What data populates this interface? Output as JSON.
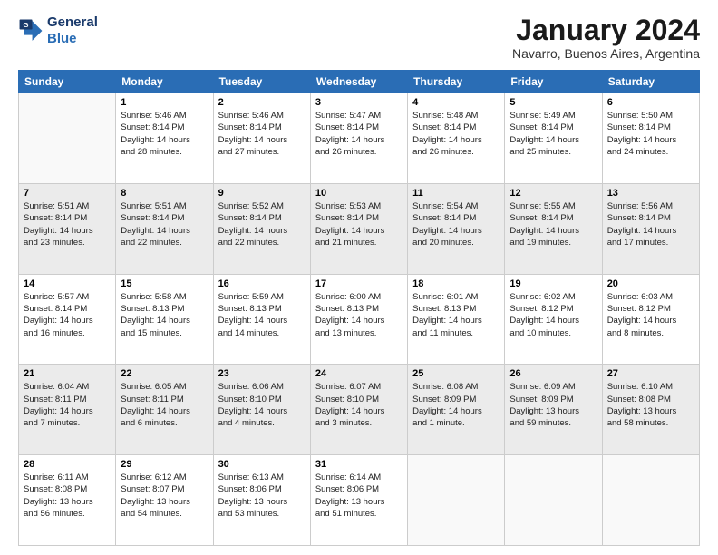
{
  "logo": {
    "line1": "General",
    "line2": "Blue"
  },
  "title": "January 2024",
  "subtitle": "Navarro, Buenos Aires, Argentina",
  "days_of_week": [
    "Sunday",
    "Monday",
    "Tuesday",
    "Wednesday",
    "Thursday",
    "Friday",
    "Saturday"
  ],
  "weeks": [
    [
      {
        "num": "",
        "info": ""
      },
      {
        "num": "1",
        "info": "Sunrise: 5:46 AM\nSunset: 8:14 PM\nDaylight: 14 hours\nand 28 minutes."
      },
      {
        "num": "2",
        "info": "Sunrise: 5:46 AM\nSunset: 8:14 PM\nDaylight: 14 hours\nand 27 minutes."
      },
      {
        "num": "3",
        "info": "Sunrise: 5:47 AM\nSunset: 8:14 PM\nDaylight: 14 hours\nand 26 minutes."
      },
      {
        "num": "4",
        "info": "Sunrise: 5:48 AM\nSunset: 8:14 PM\nDaylight: 14 hours\nand 26 minutes."
      },
      {
        "num": "5",
        "info": "Sunrise: 5:49 AM\nSunset: 8:14 PM\nDaylight: 14 hours\nand 25 minutes."
      },
      {
        "num": "6",
        "info": "Sunrise: 5:50 AM\nSunset: 8:14 PM\nDaylight: 14 hours\nand 24 minutes."
      }
    ],
    [
      {
        "num": "7",
        "info": "Sunrise: 5:51 AM\nSunset: 8:14 PM\nDaylight: 14 hours\nand 23 minutes."
      },
      {
        "num": "8",
        "info": "Sunrise: 5:51 AM\nSunset: 8:14 PM\nDaylight: 14 hours\nand 22 minutes."
      },
      {
        "num": "9",
        "info": "Sunrise: 5:52 AM\nSunset: 8:14 PM\nDaylight: 14 hours\nand 22 minutes."
      },
      {
        "num": "10",
        "info": "Sunrise: 5:53 AM\nSunset: 8:14 PM\nDaylight: 14 hours\nand 21 minutes."
      },
      {
        "num": "11",
        "info": "Sunrise: 5:54 AM\nSunset: 8:14 PM\nDaylight: 14 hours\nand 20 minutes."
      },
      {
        "num": "12",
        "info": "Sunrise: 5:55 AM\nSunset: 8:14 PM\nDaylight: 14 hours\nand 19 minutes."
      },
      {
        "num": "13",
        "info": "Sunrise: 5:56 AM\nSunset: 8:14 PM\nDaylight: 14 hours\nand 17 minutes."
      }
    ],
    [
      {
        "num": "14",
        "info": "Sunrise: 5:57 AM\nSunset: 8:14 PM\nDaylight: 14 hours\nand 16 minutes."
      },
      {
        "num": "15",
        "info": "Sunrise: 5:58 AM\nSunset: 8:13 PM\nDaylight: 14 hours\nand 15 minutes."
      },
      {
        "num": "16",
        "info": "Sunrise: 5:59 AM\nSunset: 8:13 PM\nDaylight: 14 hours\nand 14 minutes."
      },
      {
        "num": "17",
        "info": "Sunrise: 6:00 AM\nSunset: 8:13 PM\nDaylight: 14 hours\nand 13 minutes."
      },
      {
        "num": "18",
        "info": "Sunrise: 6:01 AM\nSunset: 8:13 PM\nDaylight: 14 hours\nand 11 minutes."
      },
      {
        "num": "19",
        "info": "Sunrise: 6:02 AM\nSunset: 8:12 PM\nDaylight: 14 hours\nand 10 minutes."
      },
      {
        "num": "20",
        "info": "Sunrise: 6:03 AM\nSunset: 8:12 PM\nDaylight: 14 hours\nand 8 minutes."
      }
    ],
    [
      {
        "num": "21",
        "info": "Sunrise: 6:04 AM\nSunset: 8:11 PM\nDaylight: 14 hours\nand 7 minutes."
      },
      {
        "num": "22",
        "info": "Sunrise: 6:05 AM\nSunset: 8:11 PM\nDaylight: 14 hours\nand 6 minutes."
      },
      {
        "num": "23",
        "info": "Sunrise: 6:06 AM\nSunset: 8:10 PM\nDaylight: 14 hours\nand 4 minutes."
      },
      {
        "num": "24",
        "info": "Sunrise: 6:07 AM\nSunset: 8:10 PM\nDaylight: 14 hours\nand 3 minutes."
      },
      {
        "num": "25",
        "info": "Sunrise: 6:08 AM\nSunset: 8:09 PM\nDaylight: 14 hours\nand 1 minute."
      },
      {
        "num": "26",
        "info": "Sunrise: 6:09 AM\nSunset: 8:09 PM\nDaylight: 13 hours\nand 59 minutes."
      },
      {
        "num": "27",
        "info": "Sunrise: 6:10 AM\nSunset: 8:08 PM\nDaylight: 13 hours\nand 58 minutes."
      }
    ],
    [
      {
        "num": "28",
        "info": "Sunrise: 6:11 AM\nSunset: 8:08 PM\nDaylight: 13 hours\nand 56 minutes."
      },
      {
        "num": "29",
        "info": "Sunrise: 6:12 AM\nSunset: 8:07 PM\nDaylight: 13 hours\nand 54 minutes."
      },
      {
        "num": "30",
        "info": "Sunrise: 6:13 AM\nSunset: 8:06 PM\nDaylight: 13 hours\nand 53 minutes."
      },
      {
        "num": "31",
        "info": "Sunrise: 6:14 AM\nSunset: 8:06 PM\nDaylight: 13 hours\nand 51 minutes."
      },
      {
        "num": "",
        "info": ""
      },
      {
        "num": "",
        "info": ""
      },
      {
        "num": "",
        "info": ""
      }
    ]
  ]
}
